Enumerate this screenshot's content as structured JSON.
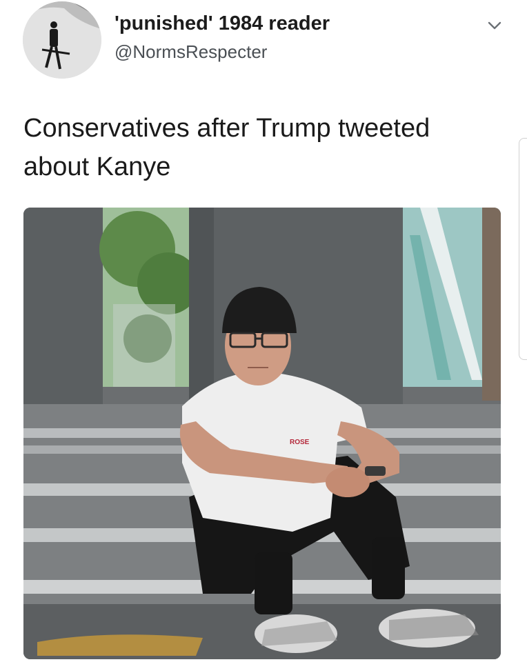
{
  "tweet": {
    "display_name": "'punished' 1984 reader",
    "handle": "@NormsRespecter",
    "text": "Conservatives after Trump tweeted\nabout Kanye",
    "menu_icon": "chevron-down-icon"
  },
  "media": {
    "shirt_logo_text": "ROSE"
  },
  "colors": {
    "text": "#14171a",
    "secondary": "#4a4f54",
    "pillar": "#5b5f61",
    "hat": "#1c1c1c"
  }
}
